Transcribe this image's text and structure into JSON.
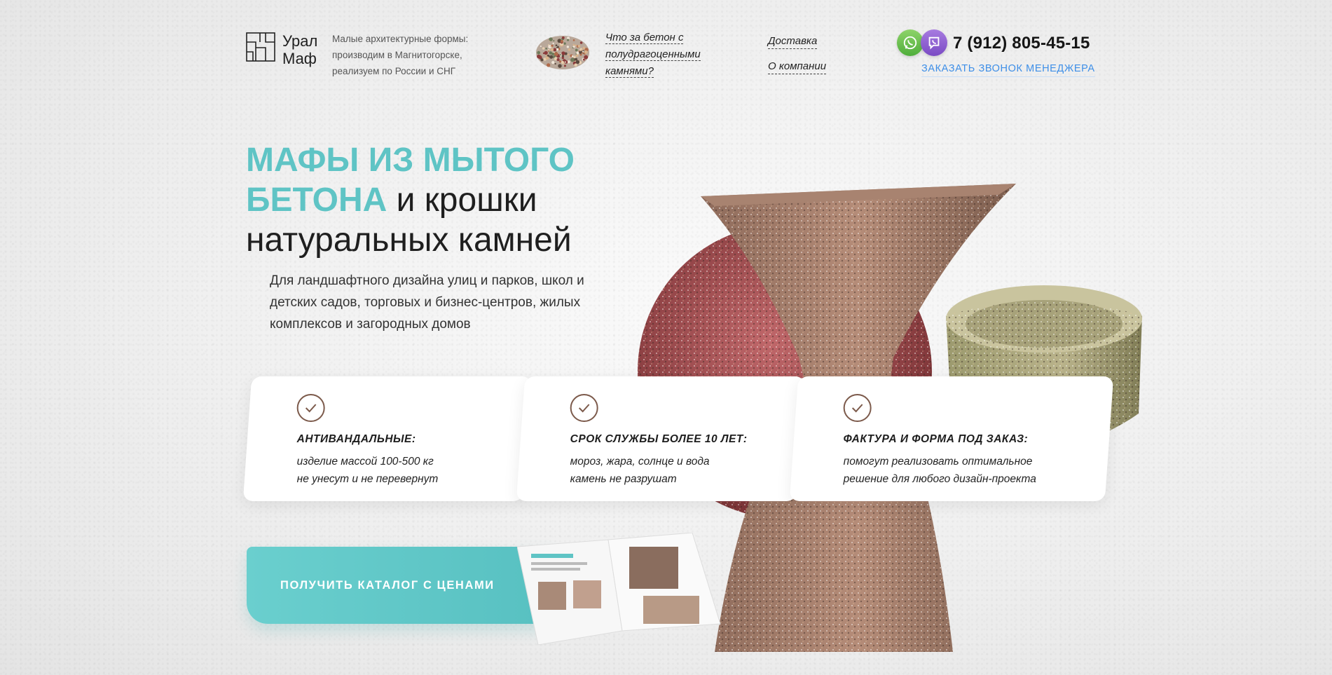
{
  "header": {
    "logo_line1": "Урал",
    "logo_line2": "Маф",
    "tagline": "Малые архитектурные формы: производим в Магнитогорске, реализуем по России и СНГ",
    "concrete_link": "Что за бетон с полудрагоценными камнями?",
    "nav": [
      "Доставка",
      "О компании"
    ],
    "phone": "7 (912) 805-45-15",
    "callback": "ЗАКАЗАТЬ ЗВОНОК МЕНЕДЖЕРА"
  },
  "hero": {
    "title_accent_1": "МАФЫ ИЗ МЫТОГО",
    "title_accent_2": "БЕТОНА",
    "title_plain_1": " и крошки",
    "title_plain_2": "натуральных камней",
    "subtitle": "Для ландшафтного дизайна улиц и парков, школ и детских садов, торговых и бизнес-центров, жилых комплексов и загородных домов"
  },
  "features": [
    {
      "title": "АНТИВАНДАЛЬНЫЕ:",
      "line1": "изделие массой 100-500 кг",
      "line2": "не унесут и не перевернут"
    },
    {
      "title": "СРОК СЛУЖБЫ БОЛЕЕ 10 ЛЕТ:",
      "line1": "мороз, жара, солнце и вода",
      "line2": "камень не разрушат"
    },
    {
      "title": "ФАКТУРА И ФОРМА ПОД ЗАКАЗ:",
      "line1": "помогут реализовать оптимальное",
      "line2": "решение для любого дизайн-проекта"
    }
  ],
  "cta": {
    "label": "ПОЛУЧИТЬ КАТАЛОГ С ЦЕНАМИ"
  },
  "colors": {
    "accent": "#5fc4c5",
    "link": "#3e8fe8",
    "check": "#7c5a4b"
  },
  "icons": [
    "logo-mark-icon",
    "whatsapp-icon",
    "viber-icon",
    "check-icon"
  ]
}
